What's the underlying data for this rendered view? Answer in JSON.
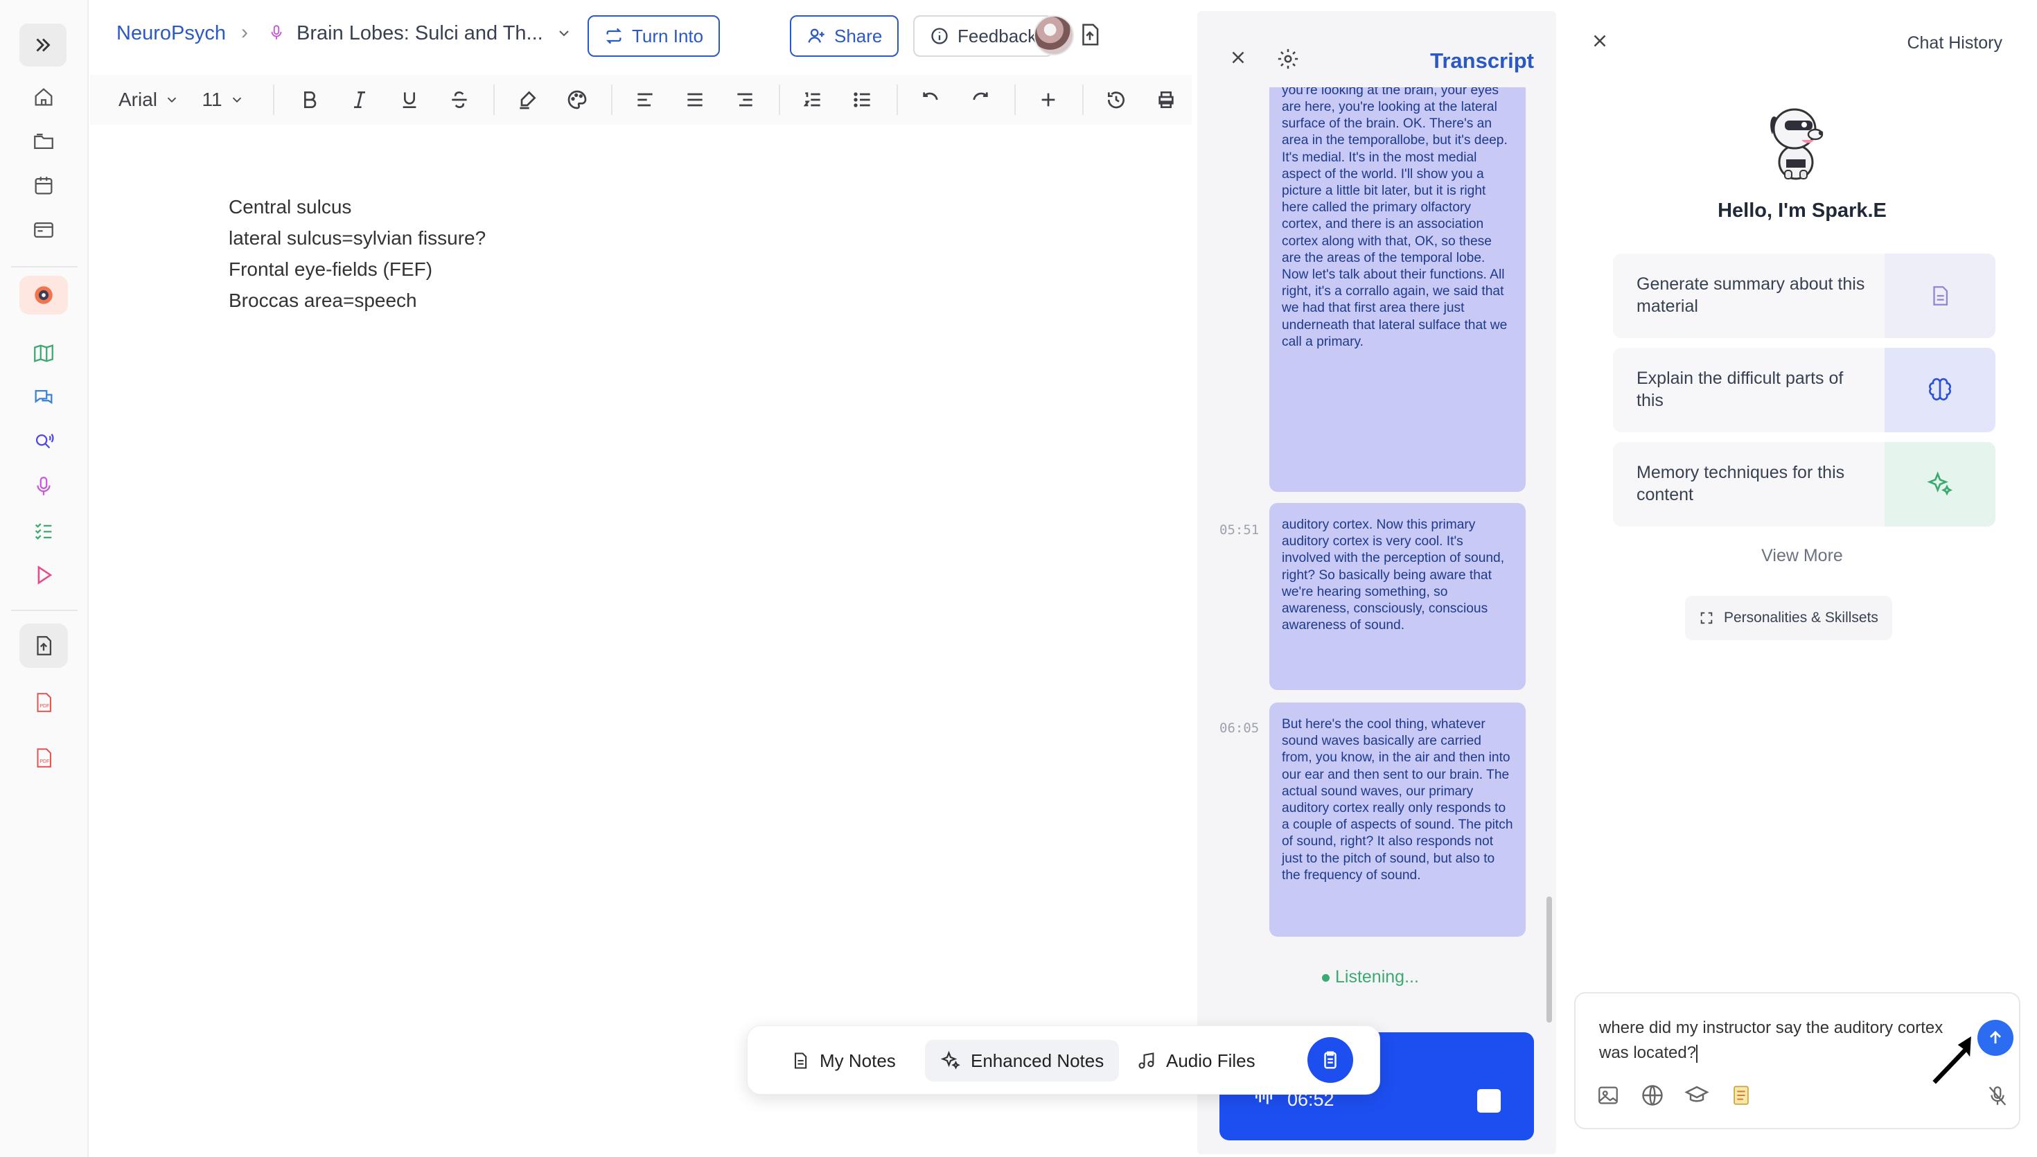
{
  "breadcrumb": {
    "course": "NeuroPsych",
    "note_title": "Brain Lobes: Sulci and Th..."
  },
  "topbar": {
    "turn_into_label": "Turn Into",
    "share_label": "Share",
    "feedback_label": "Feedback"
  },
  "toolbar": {
    "font_family": "Arial",
    "font_size": "11"
  },
  "editor": {
    "lines": [
      "Central sulcus",
      "lateral sulcus=sylvian fissure?",
      "Frontal eye-fields (FEF)",
      "Broccas area=speech"
    ]
  },
  "transcript": {
    "title": "Transcript",
    "entries": [
      {
        "time": "",
        "text": "hemisphere. So usually the left side of the brain from more commonly right-handed people. Now this other area, this is a lateral surface of the brain. So you're looking at the brain, your eyes are here, you're looking at the lateral surface of the brain. OK. There's an area in the temporallobe, but it's deep. It's medial. It's in the most medial aspect of the world. I'll show you a picture a little bit later, but it is right here called the primary olfactory cortex, and there is an association cortex along with that, OK, so these are the areas of the temporal lobe. Now let's talk about their functions. All right, it's a corrallo again, we said that we had that first area there just underneath that lateral sulface that we call a primary."
      },
      {
        "time": "05:51",
        "text": "auditory cortex. Now this primary auditory cortex is very cool. It's involved with the perception of sound, right? So basically being aware that we're hearing something, so awareness, consciously, conscious awareness of sound."
      },
      {
        "time": "06:05",
        "text": "But here's the cool thing, whatever sound waves basically are carried from, you know, in the air and then into our ear and then sent to our brain. The actual sound waves, our primary auditory cortex really only responds to a couple of aspects of sound. The pitch of sound, right? It also responds not just to the pitch of sound, but also to the frequency of sound."
      }
    ],
    "status": "Listening...",
    "recording_time": "06:52"
  },
  "bottom_tabs": {
    "my_notes": "My Notes",
    "enhanced_notes": "Enhanced Notes",
    "audio_files": "Audio Files"
  },
  "chat": {
    "history_label": "Chat History",
    "greeting": "Hello, I'm Spark.E",
    "suggestions": [
      {
        "label": "Generate summary about this material",
        "icon": "document-icon",
        "bg": "#eeeef8"
      },
      {
        "label": "Explain the difficult parts of this",
        "icon": "brain-icon",
        "bg": "#e3e6fb"
      },
      {
        "label": "Memory techniques for this content",
        "icon": "sparkle-icon",
        "bg": "#e6f4ee"
      }
    ],
    "view_more": "View More",
    "personalities_label": "Personalities & Skillsets",
    "input_value": "where did my instructor say the auditory cortex was located?"
  },
  "colors": {
    "accent": "#2b59c3",
    "recording": "#1d4ef0",
    "bubble": "#c8c9f5",
    "listening": "#3aaa70"
  }
}
